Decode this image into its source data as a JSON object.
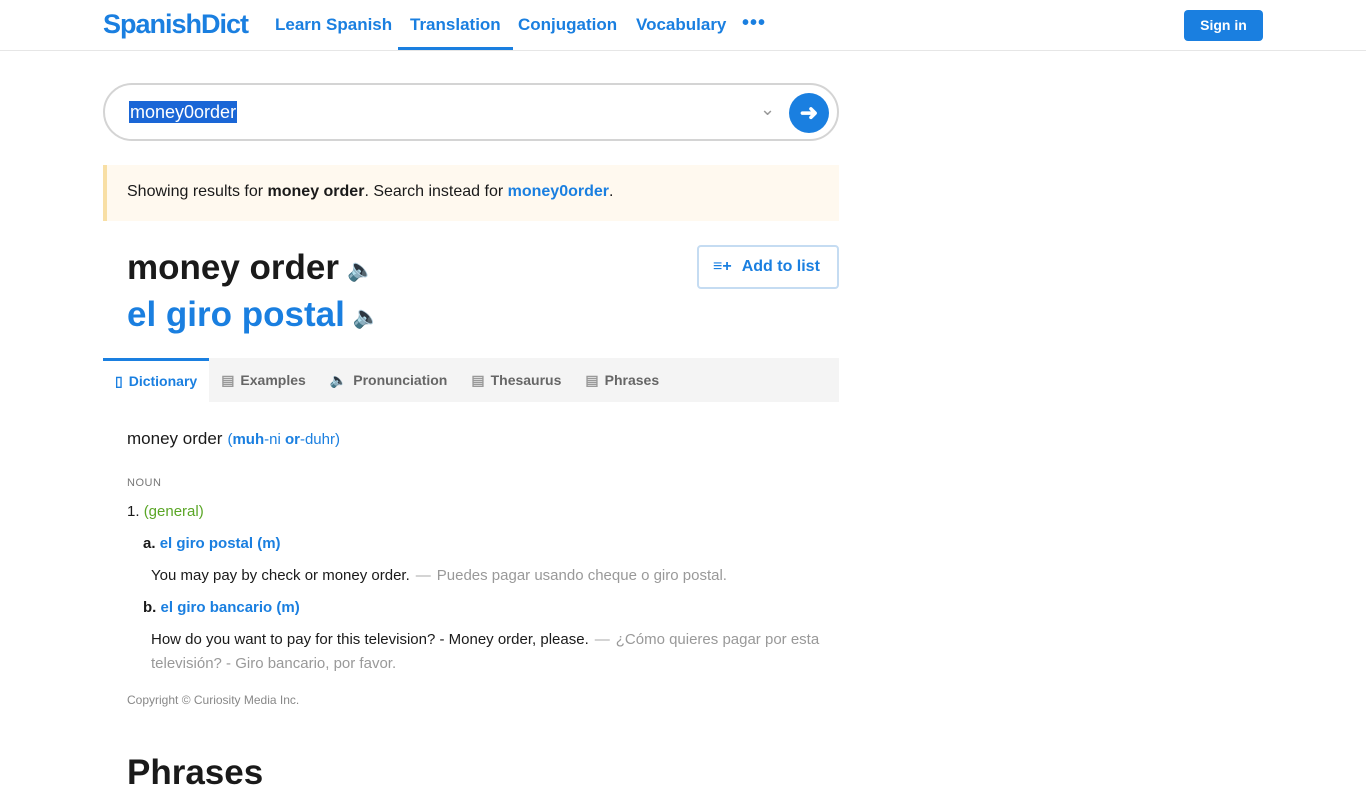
{
  "nav": {
    "logo": "SpanishDict",
    "links": [
      "Learn Spanish",
      "Translation",
      "Conjugation",
      "Vocabulary"
    ],
    "active": "Translation",
    "more": "•••",
    "sign_in": "Sign in"
  },
  "search": {
    "value": "money0order"
  },
  "notice": {
    "prefix": "Showing results for ",
    "corrected": "money order",
    "middle": ". Search instead for ",
    "original": "money0order",
    "suffix": "."
  },
  "entry": {
    "headword": "money order",
    "translation": "el giro postal",
    "add_to_list": "Add to list"
  },
  "tabs": [
    "Dictionary",
    "Examples",
    "Pronunciation",
    "Thesaurus",
    "Phrases"
  ],
  "dictionary": {
    "headword": "money order",
    "pron_open": "(",
    "pron_1": "muh",
    "pron_2": "-ni ",
    "pron_3": "or",
    "pron_4": "-duhr)",
    "pos": "NOUN",
    "sense_num": "1.",
    "sense_label": "(general)",
    "translations": [
      {
        "letter": "a.",
        "text": "el giro postal (m)",
        "ex_en": "You may pay by check or money order.",
        "ex_es": "Puedes pagar usando cheque o giro postal."
      },
      {
        "letter": "b.",
        "text": "el giro bancario (m)",
        "ex_en": "How do you want to pay for this television? - Money order, please.",
        "ex_es": "¿Cómo quieres pagar por esta televisión? - Giro bancario, por favor."
      }
    ],
    "dash": "—",
    "copyright": "Copyright © Curiosity Media Inc."
  },
  "next_section": "Phrases",
  "colors": {
    "brand": "#1a7fe0",
    "notice_bg": "#fff9ef",
    "sense": "#5aa626"
  }
}
